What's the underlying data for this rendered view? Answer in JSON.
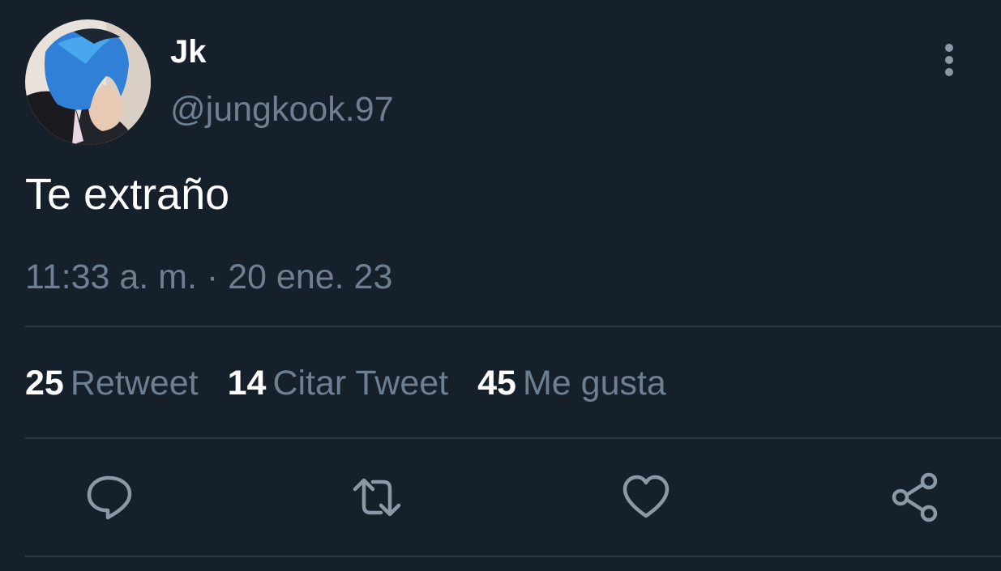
{
  "tweet": {
    "author": {
      "display_name": "Jk",
      "handle": "@jungkook.97"
    },
    "text": "Te extraño",
    "timestamp": "11:33 a. m. · 20 ene. 23"
  },
  "stats": [
    {
      "count": "25",
      "label": "Retweet"
    },
    {
      "count": "14",
      "label": "Citar Tweet"
    },
    {
      "count": "45",
      "label": "Me gusta"
    }
  ],
  "actions": [
    {
      "icon": "reply-icon"
    },
    {
      "icon": "retweet-icon"
    },
    {
      "icon": "like-heart-icon"
    },
    {
      "icon": "share-icon"
    }
  ],
  "colors": {
    "background": "#16202b",
    "primary_text": "#ffffff",
    "secondary_text": "#6e7f91",
    "divider": "#2c3845",
    "icon": "#8b99a7"
  }
}
